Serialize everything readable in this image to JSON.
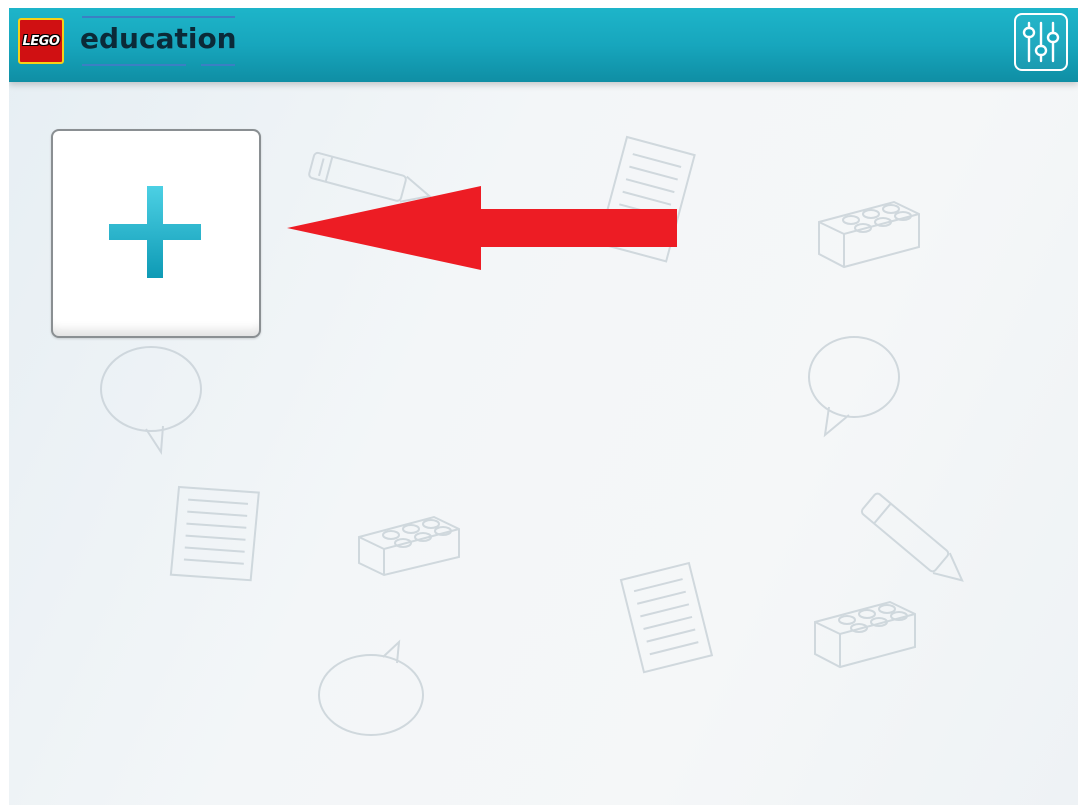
{
  "header": {
    "logo_text": "LEGO",
    "brand_text": "education",
    "settings_icon": "sliders-icon"
  },
  "workspace": {
    "new_project_icon": "plus-icon",
    "annotation": "red-arrow-pointer"
  },
  "colors": {
    "header": "#17a6bd",
    "plus": "#1bb3cf",
    "arrow": "#ed1c24",
    "logo_red": "#d01012",
    "logo_yellow": "#f7d117"
  }
}
